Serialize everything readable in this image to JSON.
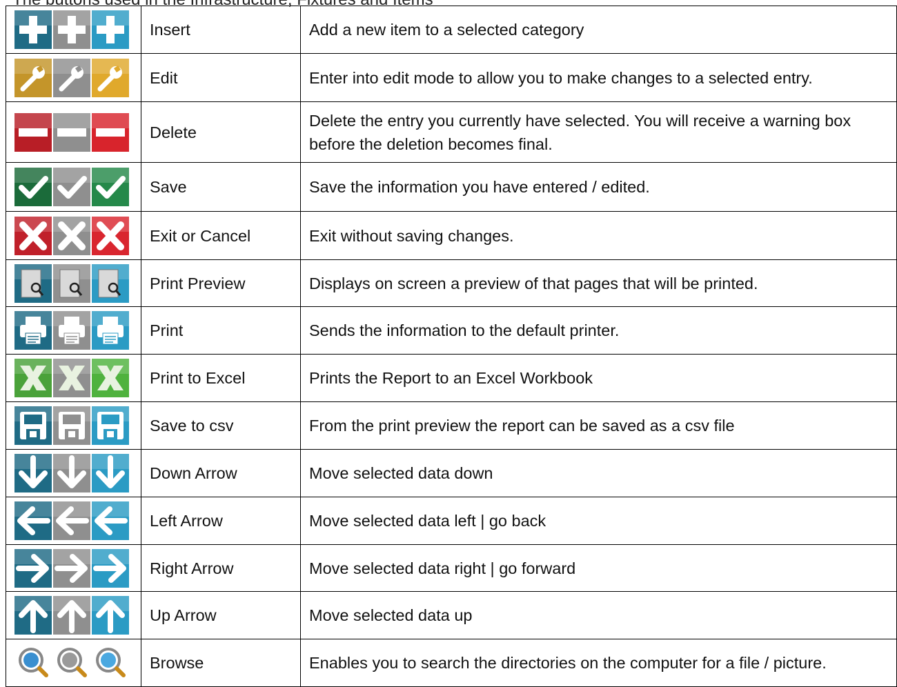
{
  "caption": "The buttons used in the Infrastructure, Fixtures and Items",
  "rows": [
    {
      "name": "Insert",
      "description": "Add a new item to a selected category",
      "icon": "plus-icon",
      "colors": [
        "#1f6b85",
        "#8f8f8f",
        "#2b9bc4"
      ]
    },
    {
      "name": "Edit",
      "description": "Enter into edit mode to allow you to make changes to a selected entry.",
      "icon": "wrench-icon",
      "colors": [
        "#c4952a",
        "#8f8f8f",
        "#e0a92c"
      ]
    },
    {
      "name": "Delete",
      "description": "Delete the entry you currently have selected.  You will receive a warning box before the deletion becomes final.",
      "icon": "minus-icon",
      "colors": [
        "#b81e26",
        "#8f8f8f",
        "#d8242c"
      ]
    },
    {
      "name": "Save",
      "description": "Save the information you have entered / edited.",
      "icon": "check-icon",
      "colors": [
        "#1b6b3a",
        "#8f8f8f",
        "#25894a"
      ]
    },
    {
      "name": "Exit or Cancel",
      "description": "Exit without saving changes.",
      "icon": "x-icon",
      "colors": [
        "#c0202a",
        "#8f8f8f",
        "#d9262f"
      ]
    },
    {
      "name": "Print Preview",
      "description": "Displays on screen a preview of that pages that will be printed.",
      "icon": "print-preview-icon",
      "colors": [
        "#1f6b85",
        "#8f8f8f",
        "#2b9bc4"
      ]
    },
    {
      "name": "Print",
      "description": "Sends the information to the default printer.",
      "icon": "printer-icon",
      "colors": [
        "#1f6b85",
        "#8f8f8f",
        "#2b9bc4"
      ]
    },
    {
      "name": "Print to Excel",
      "description": "Prints the Report to an Excel Workbook",
      "icon": "excel-icon",
      "colors": [
        "#4aa23a",
        "#8f8f8f",
        "#4fb23e"
      ]
    },
    {
      "name": "Save to csv",
      "description": "From the print preview the report can be saved as a csv file",
      "icon": "floppy-icon",
      "colors": [
        "#1f6b85",
        "#8f8f8f",
        "#2b9bc4"
      ]
    },
    {
      "name": "Down Arrow",
      "description": "Move selected data down",
      "icon": "arrow-down-icon",
      "colors": [
        "#1f6b85",
        "#8f8f8f",
        "#2b9bc4"
      ]
    },
    {
      "name": "Left Arrow",
      "description": "Move selected data left | go back",
      "icon": "arrow-left-icon",
      "colors": [
        "#1f6b85",
        "#8f8f8f",
        "#2b9bc4"
      ]
    },
    {
      "name": "Right Arrow",
      "description": "Move selected data right | go forward",
      "icon": "arrow-right-icon",
      "colors": [
        "#1f6b85",
        "#8f8f8f",
        "#2b9bc4"
      ]
    },
    {
      "name": "Up Arrow",
      "description": "Move selected data up",
      "icon": "arrow-up-icon",
      "colors": [
        "#1f6b85",
        "#8f8f8f",
        "#2b9bc4"
      ]
    },
    {
      "name": "Browse",
      "description": "Enables you to search the directories on the computer for a file / picture.",
      "icon": "magnifier-icon",
      "colors": [
        "#3a8fd0",
        "#9a9a9a",
        "#4aa8e0"
      ]
    }
  ]
}
